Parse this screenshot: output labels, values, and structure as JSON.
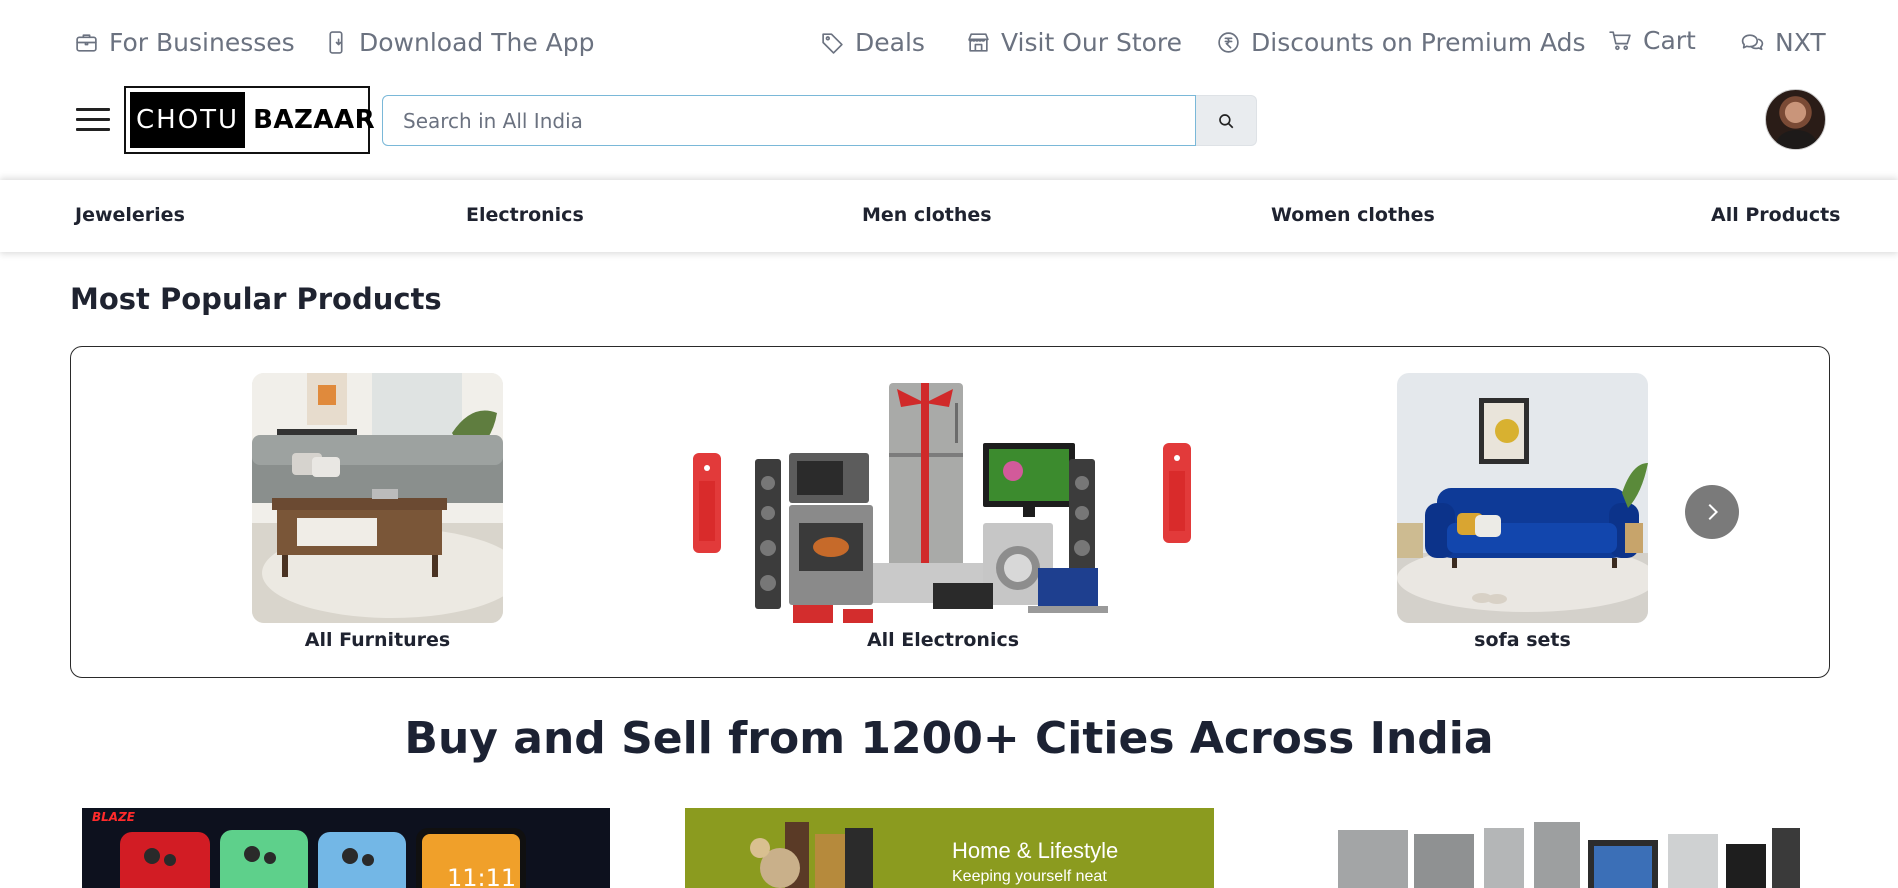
{
  "topbar": {
    "for_businesses": "For Businesses",
    "download_app": "Download The App",
    "deals": "Deals",
    "visit_store": "Visit Our Store",
    "discounts": "Discounts on Premium Ads",
    "cart": "Cart",
    "nxt": "NXT"
  },
  "header": {
    "logo_left": "CHOTU",
    "logo_right": "BAZAAR",
    "search_placeholder": "Search in All India"
  },
  "categories": [
    "Jeweleries",
    "Electronics",
    "Men clothes",
    "Women clothes",
    "All Products"
  ],
  "popular": {
    "title": "Most Popular Products",
    "items": [
      "All Furnitures",
      "All Electronics",
      "sofa sets"
    ]
  },
  "headline": "Buy and Sell from 1200+ Cities Across India",
  "banners": {
    "phones_brand": "BLAZE",
    "phones_time": "11:11",
    "lifestyle_title": "Home & Lifestyle",
    "lifestyle_sub": "Keeping yourself neat"
  },
  "colors": {
    "muted_text": "#6b7280",
    "search_border": "#7ab8d8",
    "next_button": "#7a7a7a",
    "lifestyle_banner": "#8a9a1e"
  }
}
